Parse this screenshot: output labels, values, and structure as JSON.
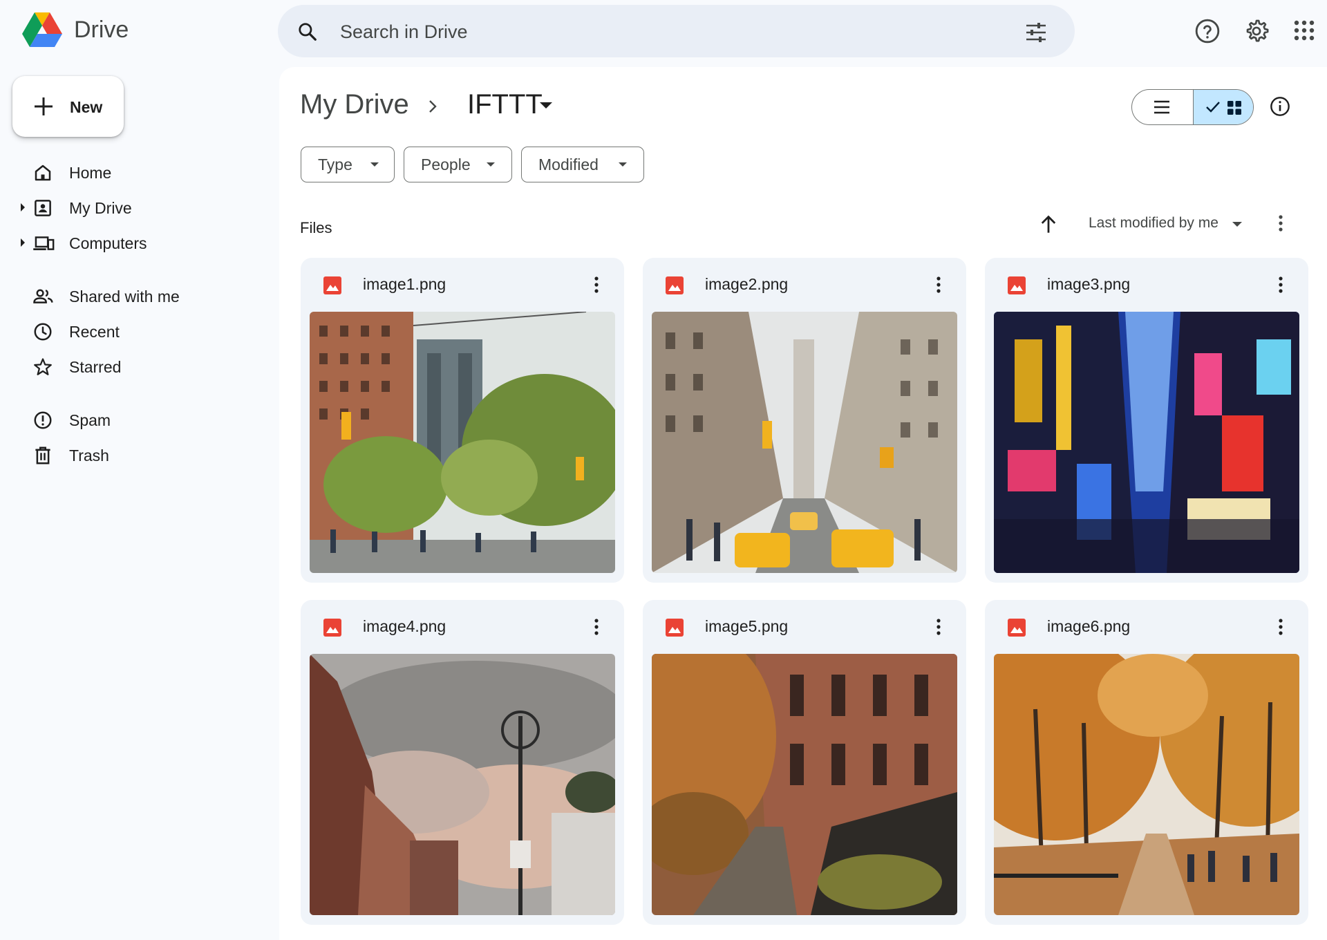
{
  "app": {
    "brand": "Drive"
  },
  "search": {
    "placeholder": "Search in Drive"
  },
  "sidebar": {
    "new_label": "New",
    "items": [
      {
        "label": "Home",
        "icon": "home-icon",
        "expandable": false
      },
      {
        "label": "My Drive",
        "icon": "my-drive-icon",
        "expandable": true
      },
      {
        "label": "Computers",
        "icon": "computers-icon",
        "expandable": true
      },
      {
        "label": "Shared with me",
        "icon": "people-icon",
        "expandable": false
      },
      {
        "label": "Recent",
        "icon": "clock-icon",
        "expandable": false
      },
      {
        "label": "Starred",
        "icon": "star-icon",
        "expandable": false
      },
      {
        "label": "Spam",
        "icon": "spam-icon",
        "expandable": false
      },
      {
        "label": "Trash",
        "icon": "trash-icon",
        "expandable": false
      }
    ]
  },
  "breadcrumb": {
    "root": "My Drive",
    "current": "IFTTT"
  },
  "view": {
    "mode": "grid"
  },
  "filters": [
    {
      "label": "Type"
    },
    {
      "label": "People"
    },
    {
      "label": "Modified"
    }
  ],
  "files": {
    "heading": "Files",
    "sort_label": "Last modified by me",
    "sort_direction": "ascending",
    "items": [
      {
        "name": "image1.png",
        "thumb": "city street with bridge and green trees"
      },
      {
        "name": "image2.png",
        "thumb": "busy avenue with yellow taxis"
      },
      {
        "name": "image3.png",
        "thumb": "neon billboards at night"
      },
      {
        "name": "image4.png",
        "thumb": "street lamp under cloudy sky"
      },
      {
        "name": "image5.png",
        "thumb": "brownstone row houses in autumn"
      },
      {
        "name": "image6.png",
        "thumb": "park path with orange autumn trees"
      }
    ]
  },
  "colors": {
    "accent": "#c2e7ff",
    "image_file_icon": "#ea4335",
    "background": "#f8fafd",
    "card": "#f0f4f9"
  }
}
